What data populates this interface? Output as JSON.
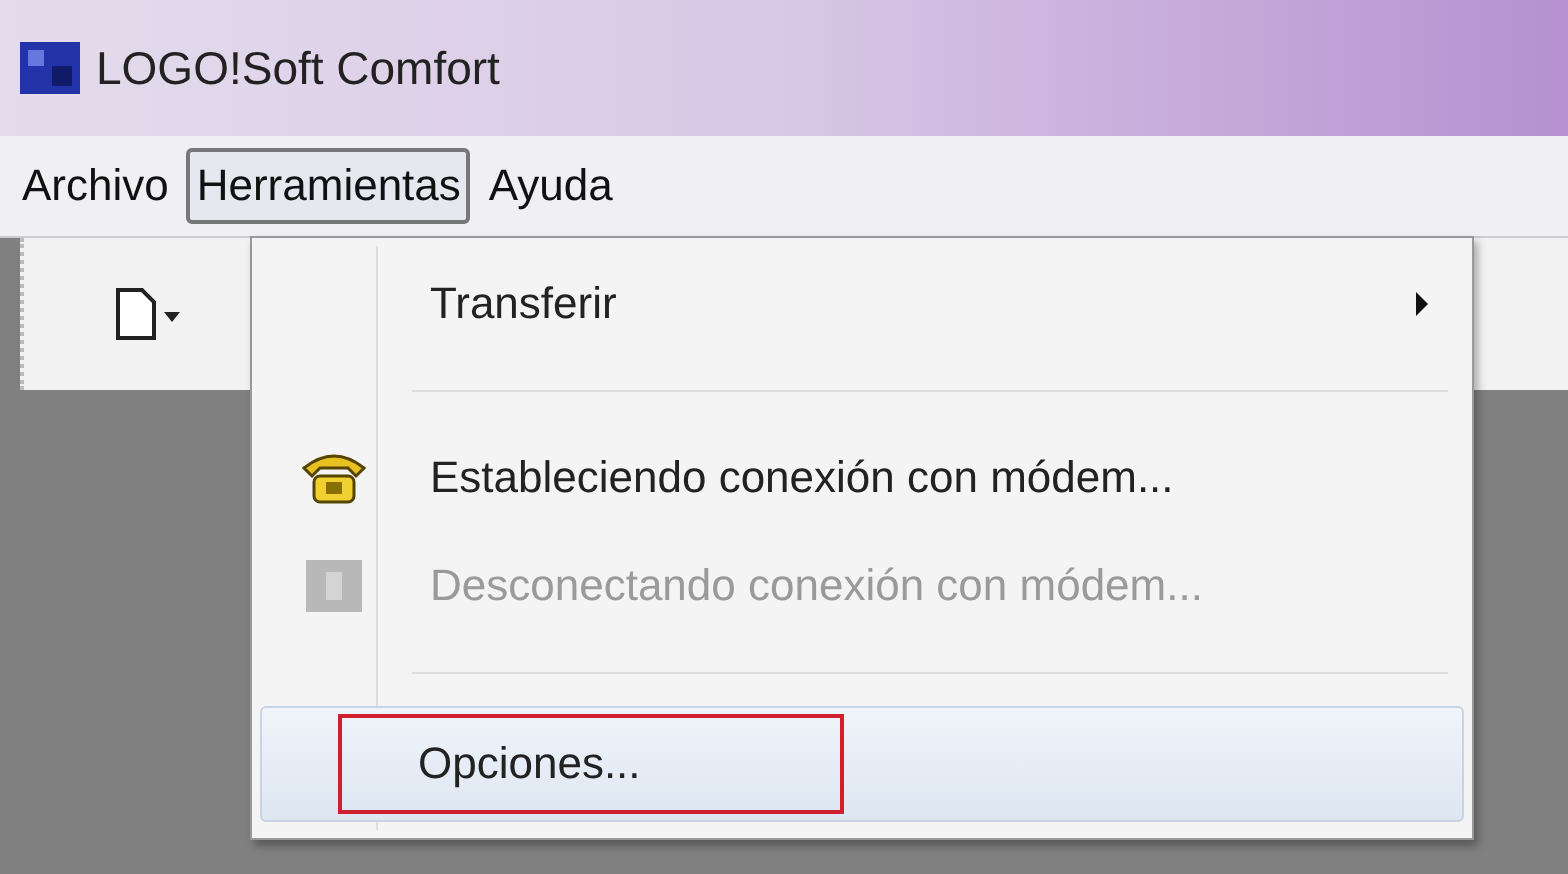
{
  "window": {
    "title": "LOGO!Soft Comfort"
  },
  "menubar": [
    {
      "label": "Archivo",
      "selected": false
    },
    {
      "label": "Herramientas",
      "selected": true
    },
    {
      "label": "Ayuda",
      "selected": false
    }
  ],
  "menu": [
    {
      "kind": "item",
      "label": "Transferir",
      "submenu": true,
      "disabled": false,
      "selected": false,
      "annotated": false
    },
    {
      "kind": "separator"
    },
    {
      "kind": "modem",
      "label": "Estableciendo conexión con módem...",
      "disabled": false,
      "selected": false,
      "annotated": false
    },
    {
      "kind": "modem",
      "label": "Desconectando conexión con módem...",
      "disabled": true,
      "selected": false,
      "annotated": false
    },
    {
      "kind": "separator"
    },
    {
      "kind": "item",
      "label": "Opciones...",
      "disabled": false,
      "selected": true,
      "annotated": true
    }
  ]
}
